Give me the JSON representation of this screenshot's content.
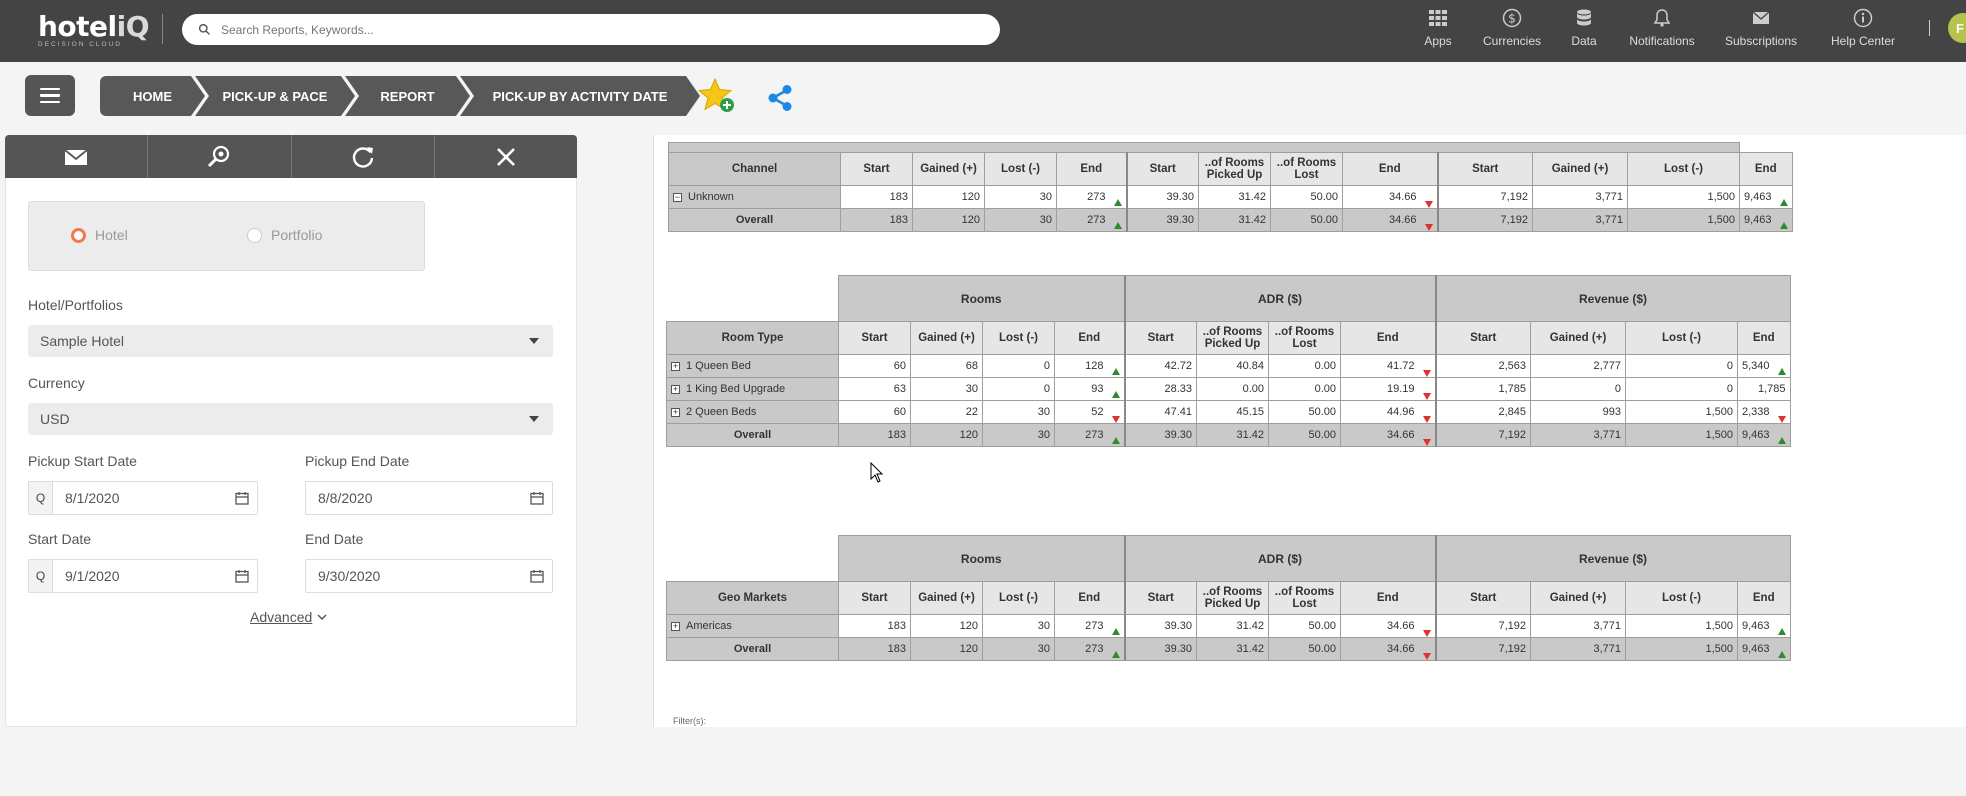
{
  "app": {
    "logo_main": "hoteliQ",
    "logo_sub": "DECISION CLOUD",
    "avatar": "F"
  },
  "search": {
    "placeholder": "Search Reports, Keywords..."
  },
  "topnav": [
    {
      "label": "Apps",
      "icon": "apps-grid-icon"
    },
    {
      "label": "Currencies",
      "icon": "currency-dollar-icon"
    },
    {
      "label": "Data",
      "icon": "database-icon"
    },
    {
      "label": "Notifications",
      "icon": "bell-icon"
    },
    {
      "label": "Subscriptions",
      "icon": "envelope-icon"
    },
    {
      "label": "Help Center",
      "icon": "info-icon"
    }
  ],
  "breadcrumbs": [
    "HOME",
    "PICK-UP & PACE",
    "REPORT",
    "PICK-UP BY ACTIVITY DATE"
  ],
  "filters": {
    "radio_hotel": "Hotel",
    "radio_portfolio": "Portfolio",
    "selected": "Hotel",
    "hotel_label": "Hotel/Portfolios",
    "hotel_value": "Sample Hotel",
    "currency_label": "Currency",
    "currency_value": "USD",
    "pickup_start_label": "Pickup Start Date",
    "pickup_start_value": "8/1/2020",
    "pickup_end_label": "Pickup End Date",
    "pickup_end_value": "8/8/2020",
    "start_label": "Start Date",
    "start_value": "9/1/2020",
    "end_label": "End Date",
    "end_value": "9/30/2020",
    "q_prefix": "Q",
    "advanced": "Advanced"
  },
  "report": {
    "group_headers": [
      "Rooms",
      "ADR ($)",
      "Revenue ($)"
    ],
    "col_headers": [
      "Start",
      "Gained (+)",
      "Lost (-)",
      "End",
      "Start",
      "..of Rooms Picked Up",
      "..of Rooms Lost",
      "End",
      "Start",
      "Gained (+)",
      "Lost (-)",
      "End"
    ],
    "overall_label": "Overall",
    "filter_label": "Filter(s):",
    "tables": [
      {
        "dimension": "Channel",
        "show_groups": false,
        "rows": [
          {
            "name": "Unknown",
            "values": [
              "183",
              "120",
              "30",
              "273",
              "39.30",
              "31.42",
              "50.00",
              "34.66",
              "7,192",
              "3,771",
              "1,500",
              "9,463"
            ],
            "trends": [
              "up",
              "down",
              "up"
            ]
          }
        ],
        "overall": {
          "values": [
            "183",
            "120",
            "30",
            "273",
            "39.30",
            "31.42",
            "50.00",
            "34.66",
            "7,192",
            "3,771",
            "1,500",
            "9,463"
          ],
          "trends": [
            "up",
            "down",
            "up"
          ]
        }
      },
      {
        "dimension": "Room Type",
        "show_groups": true,
        "rows": [
          {
            "name": "1 Queen Bed",
            "values": [
              "60",
              "68",
              "0",
              "128",
              "42.72",
              "40.84",
              "0.00",
              "41.72",
              "2,563",
              "2,777",
              "0",
              "5,340"
            ],
            "trends": [
              "up",
              "down",
              "up"
            ]
          },
          {
            "name": "1 King Bed Upgrade",
            "values": [
              "63",
              "30",
              "0",
              "93",
              "28.33",
              "0.00",
              "0.00",
              "19.19",
              "1,785",
              "0",
              "0",
              "1,785"
            ],
            "trends": [
              "up",
              "down",
              ""
            ]
          },
          {
            "name": "2 Queen Beds",
            "values": [
              "60",
              "22",
              "30",
              "52",
              "47.41",
              "45.15",
              "50.00",
              "44.96",
              "2,845",
              "993",
              "1,500",
              "2,338"
            ],
            "trends": [
              "down",
              "down",
              "down"
            ]
          }
        ],
        "overall": {
          "values": [
            "183",
            "120",
            "30",
            "273",
            "39.30",
            "31.42",
            "50.00",
            "34.66",
            "7,192",
            "3,771",
            "1,500",
            "9,463"
          ],
          "trends": [
            "up",
            "down",
            "up"
          ]
        }
      },
      {
        "dimension": "Geo Markets",
        "show_groups": true,
        "rows": [
          {
            "name": "Americas",
            "values": [
              "183",
              "120",
              "30",
              "273",
              "39.30",
              "31.42",
              "50.00",
              "34.66",
              "7,192",
              "3,771",
              "1,500",
              "9,463"
            ],
            "trends": [
              "up",
              "down",
              "up"
            ]
          }
        ],
        "overall": {
          "values": [
            "183",
            "120",
            "30",
            "273",
            "39.30",
            "31.42",
            "50.00",
            "34.66",
            "7,192",
            "3,771",
            "1,500",
            "9,463"
          ],
          "trends": [
            "up",
            "down",
            "up"
          ]
        }
      }
    ]
  }
}
